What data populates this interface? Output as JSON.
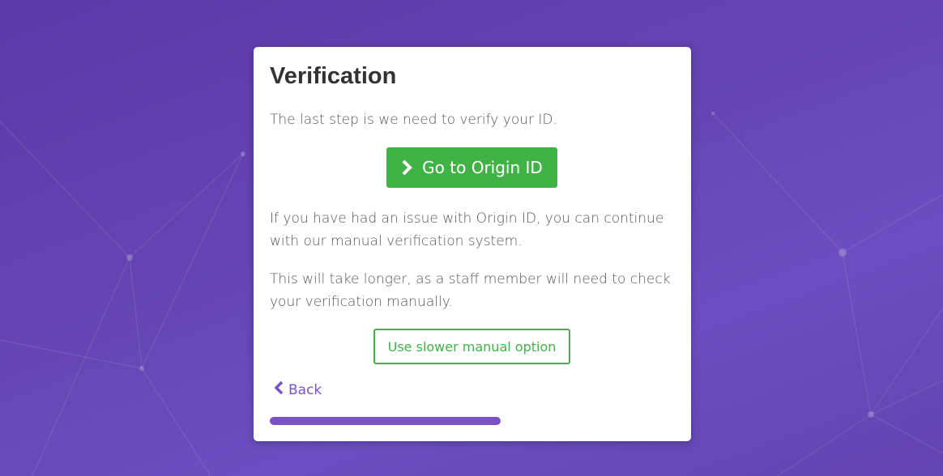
{
  "card": {
    "title": "Verification",
    "intro_text": "The last step is we need to verify your ID.",
    "primary_button_label": "Go to Origin ID",
    "issue_text": "If you have had an issue with Origin ID, you can continue with our manual verification system.",
    "warning_text": "This will take longer, as a staff member will need to check your verification manually.",
    "manual_button_label": "Use slower manual option",
    "back_label": "Back",
    "progress_fraction": 0.57
  },
  "icons": {
    "primary_button_icon": "chevron-right-icon",
    "back_icon": "chevron-left-icon"
  },
  "colors": {
    "background": "#6546b4",
    "card_bg": "#ffffff",
    "accent_green": "#41b346",
    "accent_purple": "#7a52c4",
    "title_text": "#333333",
    "body_text": "#555555"
  }
}
